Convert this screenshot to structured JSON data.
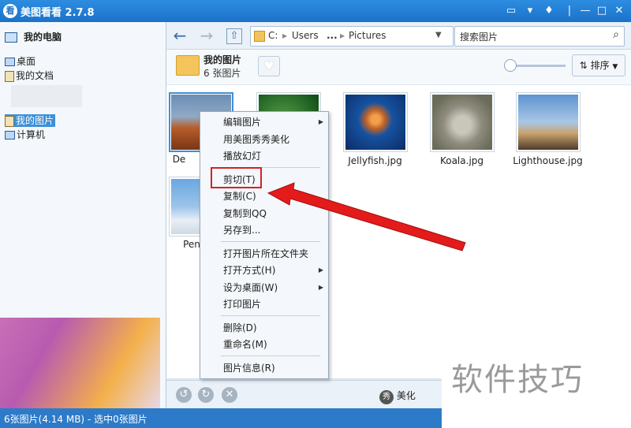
{
  "window": {
    "title": "美图看看 2.7.8",
    "logo_text": "看"
  },
  "sidebar": {
    "header": "我的电脑",
    "items": [
      {
        "label": "桌面"
      },
      {
        "label": "我的文档"
      },
      {
        "label": "我的图片"
      },
      {
        "label": "计算机"
      }
    ]
  },
  "toolbar": {
    "breadcrumbs": [
      "C:",
      "Users",
      "...",
      "Pictures"
    ],
    "search_placeholder": "搜索图片"
  },
  "folder": {
    "title": "我的图片",
    "count": "6 张图片",
    "sort_label": "排序"
  },
  "images": [
    {
      "name": "De",
      "colors": [
        "#6b8db4",
        "#b85d2b"
      ]
    },
    {
      "name": "",
      "colors": [
        "#0c4a15",
        "#58a24a"
      ]
    },
    {
      "name": "Jellyfish.jpg",
      "colors": [
        "#0c2c66",
        "#f1a04c"
      ]
    },
    {
      "name": "Koala.jpg",
      "colors": [
        "#6a6b58",
        "#c9c7bb"
      ]
    },
    {
      "name": "Lighthouse.jpg",
      "colors": [
        "#5f93cf",
        "#c9a36e"
      ]
    },
    {
      "name": "Pen",
      "colors": [
        "#6aa7e0",
        "#e8eef5"
      ]
    }
  ],
  "context_menu": {
    "items": [
      {
        "label": "编辑图片",
        "submenu": true
      },
      {
        "label": "用美图秀秀美化",
        "submenu": false
      },
      {
        "label": "播放幻灯",
        "submenu": false
      },
      {
        "label": "剪切(T)",
        "submenu": false
      },
      {
        "label": "复制(C)",
        "submenu": false
      },
      {
        "label": "复制到QQ",
        "submenu": false
      },
      {
        "label": "另存到...",
        "submenu": false
      },
      {
        "label": "打开图片所在文件夹",
        "submenu": false
      },
      {
        "label": "打开方式(H)",
        "submenu": true
      },
      {
        "label": "设为桌面(W)",
        "submenu": true
      },
      {
        "label": "打印图片",
        "submenu": false
      },
      {
        "label": "删除(D)",
        "submenu": false
      },
      {
        "label": "重命名(M)",
        "submenu": false
      },
      {
        "label": "图片信息(R)",
        "submenu": false
      }
    ]
  },
  "bottombar": {
    "beautify_label": "美化",
    "beautify_icon": "秀"
  },
  "status": {
    "text": "6张图片(4.14 MB) - 选中0张图片"
  },
  "watermark": {
    "text": "软件技巧"
  },
  "colors": {
    "titlebar": "#1b72c9",
    "highlight": "#d92020",
    "selection": "#3d8fd7"
  }
}
